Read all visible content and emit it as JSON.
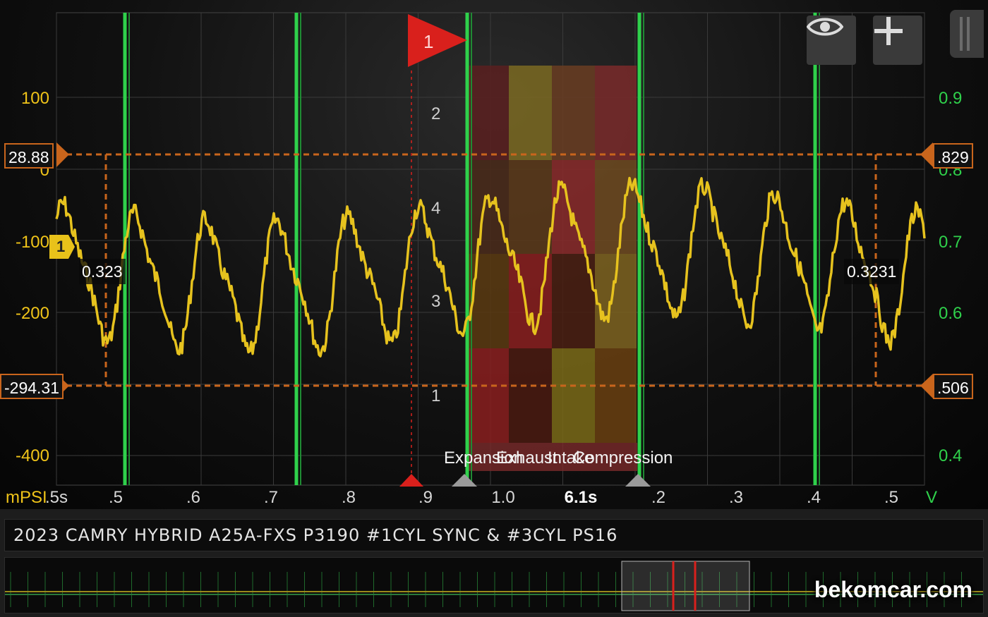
{
  "left_axis": {
    "unit": "mPSI",
    "color": "#f0c419",
    "ticks": [
      "100",
      "0",
      "-100",
      "-200",
      "-400"
    ]
  },
  "right_axis": {
    "unit": "V",
    "color": "#2fd14b",
    "ticks": [
      "0.9",
      "0.8",
      "0.7",
      "0.6",
      "0.4"
    ]
  },
  "time_axis": {
    "labels": [
      ".5s",
      ".5",
      ".6",
      ".7",
      ".8",
      ".9",
      "1.0",
      ".2",
      ".3",
      ".4",
      ".5"
    ],
    "current": "6.1s"
  },
  "cursors": {
    "left_upper": "28.88",
    "left_lower": "-294.31",
    "right_upper": ".829",
    "right_lower": ".506",
    "delta_left": "0.323",
    "delta_right": "0.3231"
  },
  "channel_marker": "1",
  "trigger_marker": "1",
  "cylinder_order": [
    "2",
    "4",
    "3",
    "1"
  ],
  "phases": [
    "Expansion",
    "Exhaust",
    "Intake",
    "Compression"
  ],
  "toolbar": {
    "eye": "eye-icon",
    "add": "plus-icon"
  },
  "title": "2023 CAMRY HYBRID A25A-FXS P3190 #1CYL SYNC & #3CYL PS16",
  "watermark": "bekomcar.com",
  "colors": {
    "pressure": "#e6c21e",
    "sync": "#2fd14b",
    "cursor": "#c9651c",
    "trigger": "#d9201c"
  }
}
